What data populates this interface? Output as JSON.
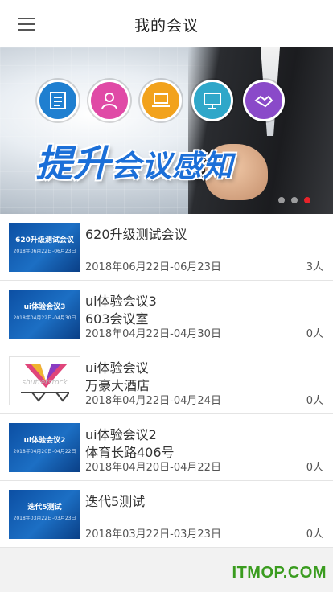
{
  "header": {
    "title": "我的会议",
    "menu_icon": "hamburger-menu-icon"
  },
  "banner": {
    "text_big": "提升",
    "text_rest": "会议感知",
    "icons": [
      "document-icon",
      "person-icon",
      "laptop-icon",
      "monitor-icon",
      "handshake-icon"
    ],
    "active_dot": 2,
    "accent": "#1b6fd8",
    "dot_active_color": "#e8232a"
  },
  "meetings": [
    {
      "thumb_title": "620升级测试会议",
      "thumb_date": "2018年06月22日-06月23日",
      "name": "620升级测试会议",
      "place": "",
      "date": "2018年06月22日-06月23日",
      "count": "3人"
    },
    {
      "thumb_title": "ui体验会议3",
      "thumb_date": "2018年04月22日-04月30日",
      "name": "ui体验会议3",
      "place": "603会议室",
      "date": "2018年04月22日-04月30日",
      "count": "0人"
    },
    {
      "thumb_title": "",
      "thumb_date": "",
      "thumb_logo_text": "shutterstock",
      "name": "ui体验会议",
      "place": "万豪大酒店",
      "date": "2018年04月22日-04月24日",
      "count": "0人"
    },
    {
      "thumb_title": "ui体验会议2",
      "thumb_date": "2018年04月20日-04月22日",
      "name": "ui体验会议2",
      "place": "体育长路406号",
      "date": "2018年04月20日-04月22日",
      "count": "0人"
    },
    {
      "thumb_title": "迭代5测试",
      "thumb_date": "2018年03月22日-03月23日",
      "name": "迭代5测试",
      "place": "",
      "date": "2018年03月22日-03月23日",
      "count": "0人"
    }
  ],
  "watermark": "ITMOP.COM"
}
